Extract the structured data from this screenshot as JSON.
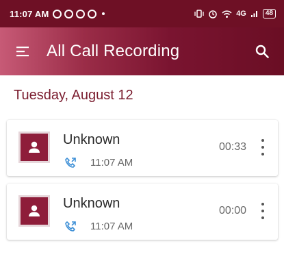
{
  "status_bar": {
    "time": "11:07 AM",
    "left_icons": [
      "whatsapp-icon",
      "whatsapp-icon",
      "whatsapp-icon",
      "whatsapp-icon",
      "notification-dot"
    ],
    "right_icons": [
      "vibrate-icon",
      "alarm-icon",
      "wifi-icon",
      "signal-icon"
    ],
    "network_label": "4G",
    "battery_level": "48"
  },
  "app_bar": {
    "title": "All Call Recording",
    "menu_icon": "menu-icon",
    "search_icon": "search-icon"
  },
  "date_header": "Tuesday, August 12",
  "recordings": [
    {
      "name": "Unknown",
      "time": "11:07 AM",
      "duration": "00:33",
      "type_icon": "outgoing-call-icon"
    },
    {
      "name": "Unknown",
      "time": "11:07 AM",
      "duration": "00:00",
      "type_icon": "outgoing-call-icon"
    }
  ],
  "colors": {
    "status_bar": "#6e1025",
    "app_bar_start": "#c75a76",
    "app_bar_end": "#6a0e24",
    "accent": "#8e1d3a",
    "date_text": "#7a1c2e",
    "call_icon": "#3d8fd6"
  }
}
